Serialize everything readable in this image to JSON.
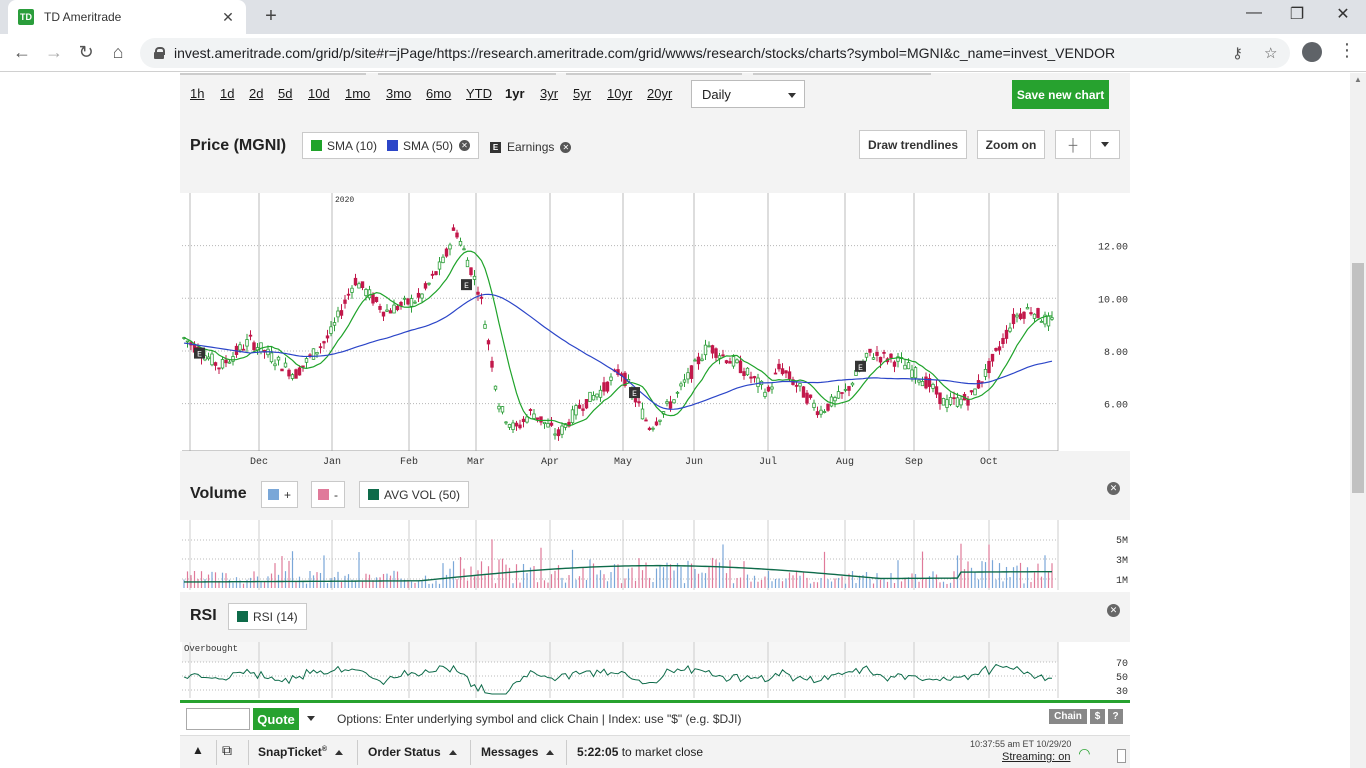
{
  "browser": {
    "tab_title": "TD Ameritrade",
    "tab_favicon_text": "TD",
    "url": "invest.ameritrade.com/grid/p/site#r=jPage/https://research.ameritrade.com/grid/wwws/research/stocks/charts?symbol=MGNI&c_name=invest_VENDOR"
  },
  "toolbar": {
    "ranges": [
      "1h",
      "1d",
      "2d",
      "5d",
      "10d",
      "1mo",
      "3mo",
      "6mo",
      "YTD",
      "1yr",
      "3yr",
      "5yr",
      "10yr",
      "20yr"
    ],
    "active_range": "1yr",
    "interval": "Daily",
    "save_label": "Save new chart"
  },
  "price_panel": {
    "title": "Price (MGNI)",
    "legend": {
      "sma10": "SMA (10)",
      "sma50": "SMA (50)",
      "earnings": "Earnings"
    },
    "draw_trendlines": "Draw trendlines",
    "zoom_on": "Zoom on",
    "year_marker": "2020",
    "y_ticks": [
      "12.00",
      "10.00",
      "8.00",
      "6.00"
    ],
    "x_labels": [
      "Dec",
      "Jan",
      "Feb",
      "Mar",
      "Apr",
      "May",
      "Jun",
      "Jul",
      "Aug",
      "Sep",
      "Oct"
    ]
  },
  "volume_panel": {
    "title": "Volume",
    "legend": {
      "up": "+",
      "down": "-",
      "avg": "AVG VOL (50)"
    },
    "y_ticks": [
      "5M",
      "3M",
      "1M"
    ]
  },
  "rsi_panel": {
    "title": "RSI",
    "legend": "RSI (14)",
    "overbought": "Overbought",
    "y_ticks": [
      "70",
      "50",
      "30"
    ]
  },
  "quote_bar": {
    "quote_label": "Quote",
    "hint": "Options: Enter underlying symbol and click Chain | Index: use \"$\" (e.g. $DJI)",
    "chain_label": "Chain",
    "dollar_label": "$",
    "help_label": "?"
  },
  "bottom_bar": {
    "snapticket": "SnapTicket",
    "snapticket_mark": "®",
    "order_status": "Order Status",
    "messages": "Messages",
    "countdown": "5:22:05",
    "countdown_suffix": "to market close",
    "timestamp": "10:37:55 am ET 10/29/20",
    "streaming": "Streaming: on"
  },
  "colors": {
    "accent_green": "#27a22f",
    "candle_up": "#2e9e3a",
    "candle_down": "#c2184b",
    "sma10": "#1fa32a",
    "sma50": "#2b45c8",
    "vol_up": "#7aa7d8",
    "vol_down": "#e07a9a",
    "avg_vol": "#0e6b4a",
    "rsi": "#0e6b4a"
  },
  "chart_data": {
    "type": "line",
    "title": "Price (MGNI)",
    "x_unit": "2019-11 to 2020-10",
    "x": [
      "Dec",
      "Jan",
      "Feb",
      "Mar",
      "Apr",
      "May",
      "Jun",
      "Jul",
      "Aug",
      "Sep",
      "Oct"
    ],
    "series": [
      {
        "name": "SMA (10)",
        "values": [
          7.6,
          7.8,
          8.9,
          11.3,
          5.8,
          6.1,
          7.8,
          7.0,
          6.9,
          7.5,
          8.6
        ]
      },
      {
        "name": "SMA (50)",
        "values": [
          8.1,
          7.9,
          8.7,
          9.7,
          8.3,
          7.0,
          6.6,
          6.8,
          6.9,
          7.1,
          7.2
        ]
      }
    ],
    "close": [
      7.6,
      7.5,
      9.4,
      10.1,
      5.5,
      6.9,
      7.6,
      6.5,
      6.5,
      6.0,
      9.2
    ],
    "ylim": [
      4.2,
      14.0
    ],
    "y_ticks": [
      6,
      8,
      10,
      12
    ],
    "grid": true,
    "earnings_markers": [
      "Nov",
      "Feb",
      "May",
      "Aug"
    ]
  }
}
